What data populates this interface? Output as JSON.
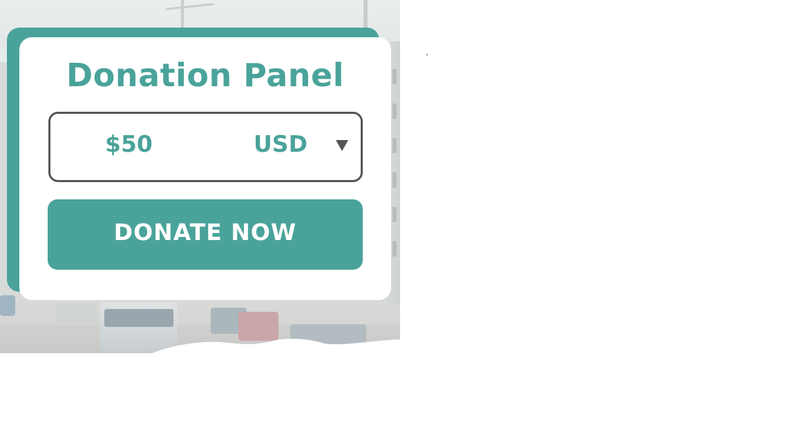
{
  "panel": {
    "title": "Donation Panel",
    "amount_value": "$50",
    "currency_selected": "USD",
    "currency_caret_icon": "caret-down-icon",
    "donate_label": "DONATE NOW"
  },
  "colors": {
    "accent": "#4aa39a",
    "border": "#555555",
    "card": "#ffffff"
  },
  "background": {
    "description_icon": "street-photo-background"
  }
}
